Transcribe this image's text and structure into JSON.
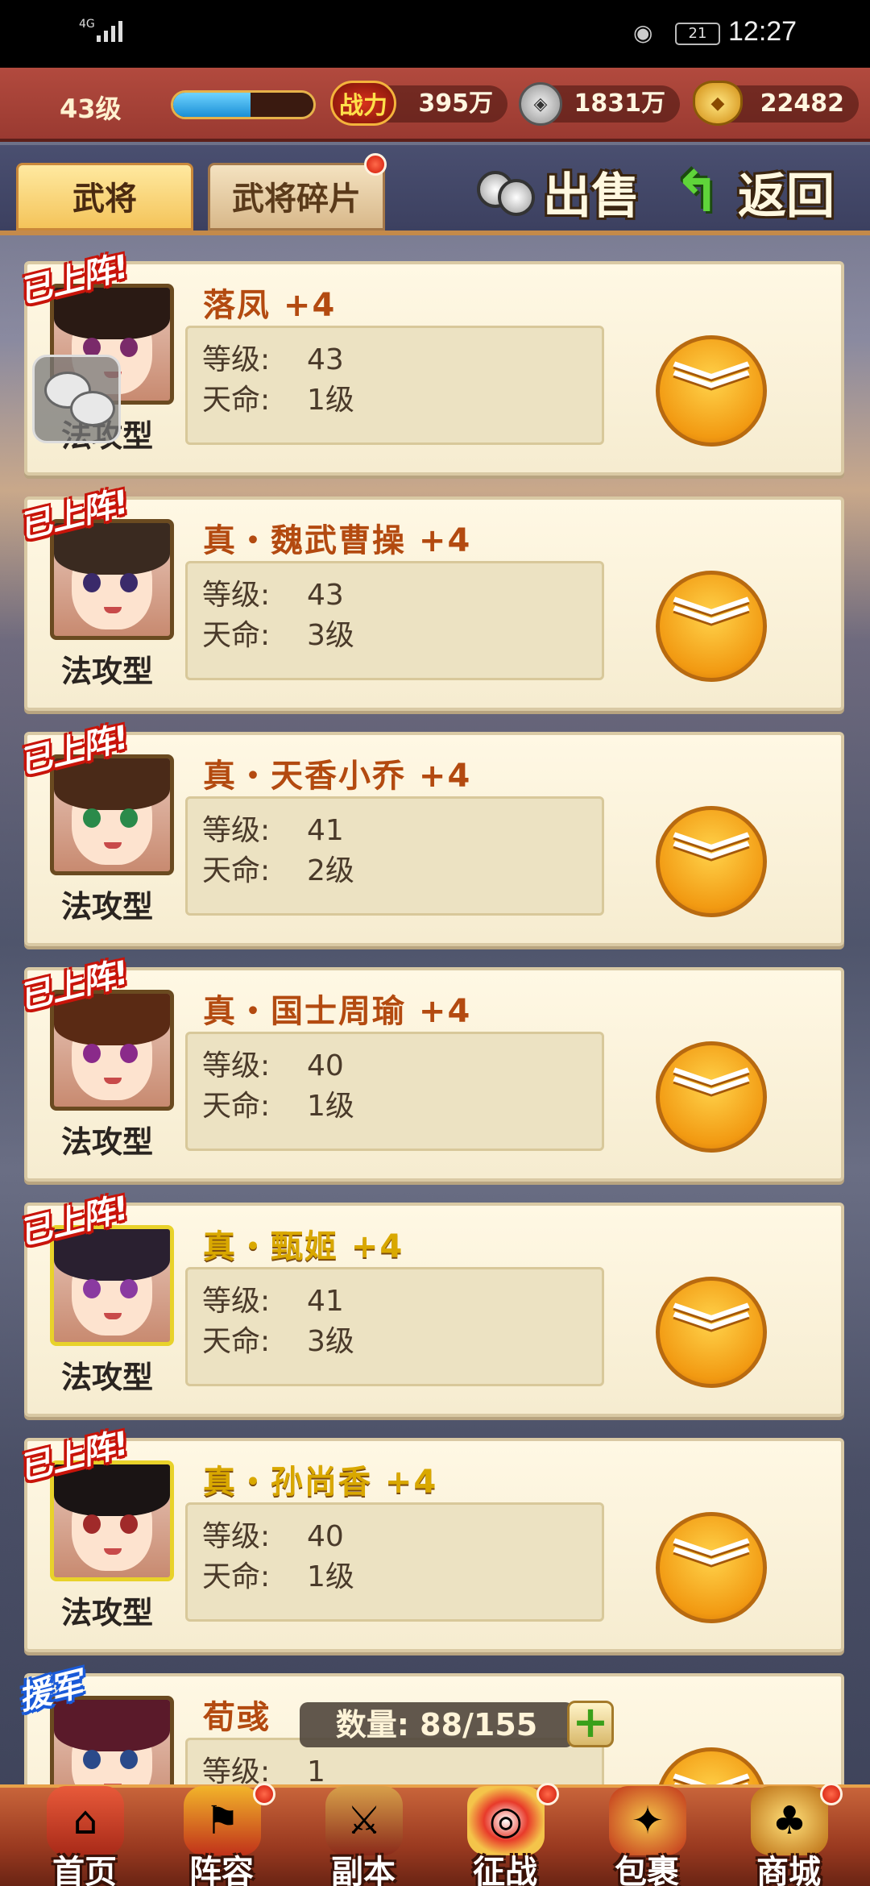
{
  "status_bar": {
    "network": "4G",
    "battery": "21",
    "time": "12:27"
  },
  "resources": {
    "level": "43级",
    "xp_fraction": 0.55,
    "power_icon_label": "战力",
    "power": "395万",
    "silver": "1831万",
    "gold": "22482"
  },
  "tabs": [
    {
      "label": "武将",
      "active": true
    },
    {
      "label": "武将碎片",
      "active": false,
      "has_badge": true
    }
  ],
  "actions": {
    "sell_label": "出售",
    "back_label": "返回"
  },
  "labels": {
    "level_key": "等级:",
    "fate_key": "天命:"
  },
  "generals": [
    {
      "tag": "已上阵!",
      "type": "法攻型",
      "name": "落凤 +4",
      "level": "43",
      "fate": "1级"
    },
    {
      "tag": "已上阵!",
      "type": "法攻型",
      "name": "真・魏武曹操 +4",
      "level": "43",
      "fate": "3级"
    },
    {
      "tag": "已上阵!",
      "type": "法攻型",
      "name": "真・天香小乔 +4",
      "level": "41",
      "fate": "2级"
    },
    {
      "tag": "已上阵!",
      "type": "法攻型",
      "name": "真・国士周瑜 +4",
      "level": "40",
      "fate": "1级"
    },
    {
      "tag": "已上阵!",
      "type": "法攻型",
      "name": "真・甄姬 +4",
      "level": "41",
      "fate": "3级"
    },
    {
      "tag": "已上阵!",
      "type": "法攻型",
      "name": "真・孙尚香 +4",
      "level": "40",
      "fate": "1级"
    },
    {
      "tag": "援军",
      "type": "",
      "name": "荀彧",
      "level": "1",
      "fate": ""
    }
  ],
  "quantity": {
    "label": "数量: 88/155"
  },
  "bottom_nav": [
    {
      "label": "首页",
      "icon": "home-icon",
      "badge": false
    },
    {
      "label": "阵容",
      "icon": "lineup-icon",
      "badge": true
    },
    {
      "label": "副本",
      "icon": "dungeon-icon",
      "badge": false
    },
    {
      "label": "征战",
      "icon": "campaign-icon",
      "badge": true
    },
    {
      "label": "包裹",
      "icon": "bag-icon",
      "badge": false
    },
    {
      "label": "商城",
      "icon": "shop-icon",
      "badge": true
    }
  ]
}
